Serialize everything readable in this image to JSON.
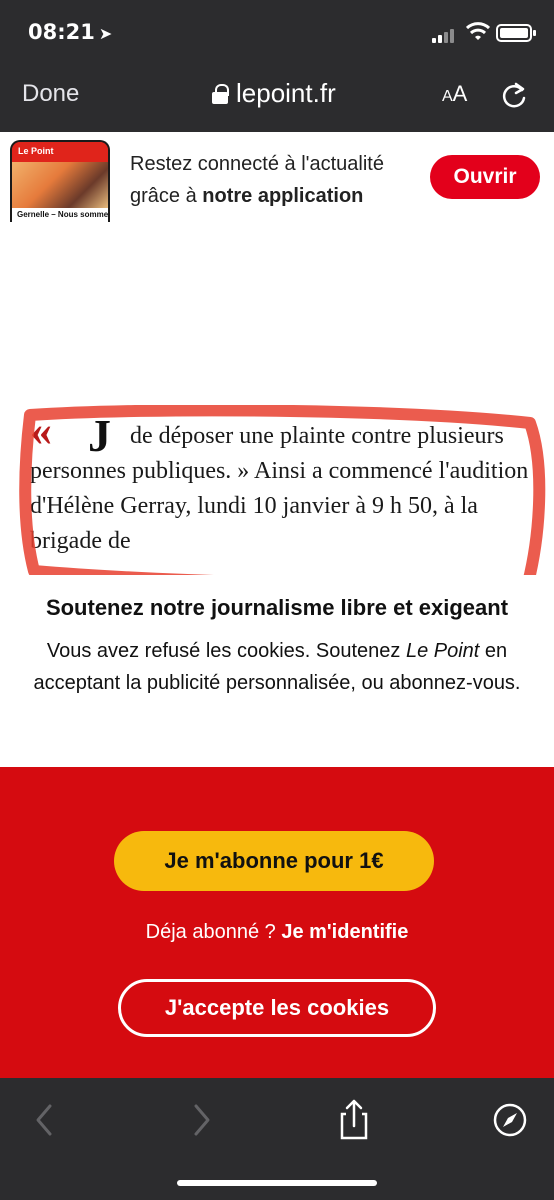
{
  "status": {
    "time": "08:21",
    "location_icon": "location-arrow-icon"
  },
  "nav": {
    "done": "Done",
    "url": "lepoint.fr",
    "text_size": "AA"
  },
  "app_banner": {
    "thumb_brand": "Le Point",
    "thumb_caption": "Gernelle – Nous sommes",
    "line1": "Restez connecté à l'actualité",
    "line2_prefix": "grâce à ",
    "line2_bold": "notre application",
    "open": "Ouvrir"
  },
  "article": {
    "quote_mark": "«",
    "dropcap": "J",
    "text": "de déposer une plainte contre plusieurs personnes publiques. » Ainsi a commencé l'audition d'Hélène Gerray, lundi 10 janvier à 9 h 50, à la brigade de"
  },
  "cookie_wall": {
    "title": "Soutenez notre journalisme libre et exigeant",
    "text_before": "Vous avez refusé les cookies. Soutenez ",
    "text_italic": "Le Point",
    "text_after": " en acceptant la publicité personnalisée, ou abonnez-vous.",
    "subscribe": "Je m'abonne pour 1€",
    "already": "Déja abonné ? ",
    "login": "Je m'identifie",
    "accept": "J'accepte les cookies"
  },
  "colors": {
    "brand_red": "#d50b10",
    "button_yellow": "#f7b90d",
    "annotation_red": "#e8402f",
    "chrome_dark": "#2c2c2e"
  }
}
